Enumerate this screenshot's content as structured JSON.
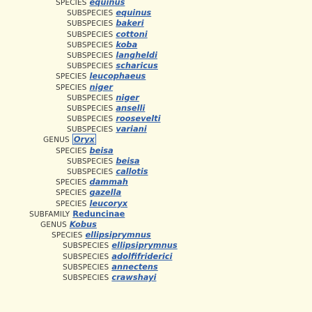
{
  "tree": [
    {
      "rank": "SPECIES",
      "name": "equinus",
      "italic": true,
      "level": "l1"
    },
    {
      "rank": "SUBSPECIES",
      "name": "equinus",
      "italic": true,
      "level": "l2"
    },
    {
      "rank": "SUBSPECIES",
      "name": "bakeri",
      "italic": true,
      "level": "l2"
    },
    {
      "rank": "SUBSPECIES",
      "name": "cottoni",
      "italic": true,
      "level": "l2"
    },
    {
      "rank": "SUBSPECIES",
      "name": "koba",
      "italic": true,
      "level": "l2"
    },
    {
      "rank": "SUBSPECIES",
      "name": "langheldi",
      "italic": true,
      "level": "l2"
    },
    {
      "rank": "SUBSPECIES",
      "name": "scharicus",
      "italic": true,
      "level": "l2"
    },
    {
      "rank": "SPECIES",
      "name": "leucophaeus",
      "italic": true,
      "level": "l1"
    },
    {
      "rank": "SPECIES",
      "name": "niger",
      "italic": true,
      "level": "l1"
    },
    {
      "rank": "SUBSPECIES",
      "name": "niger",
      "italic": true,
      "level": "l2"
    },
    {
      "rank": "SUBSPECIES",
      "name": "anselli",
      "italic": true,
      "level": "l2"
    },
    {
      "rank": "SUBSPECIES",
      "name": "roosevelti",
      "italic": true,
      "level": "l2"
    },
    {
      "rank": "SUBSPECIES",
      "name": "variani",
      "italic": true,
      "level": "l2"
    },
    {
      "rank": "GENUS",
      "name": "Oryx",
      "italic": true,
      "level": "l0",
      "boxed": true
    },
    {
      "rank": "SPECIES",
      "name": "beisa",
      "italic": true,
      "level": "l1"
    },
    {
      "rank": "SUBSPECIES",
      "name": "beisa",
      "italic": true,
      "level": "l2"
    },
    {
      "rank": "SUBSPECIES",
      "name": "callotis",
      "italic": true,
      "level": "l2"
    },
    {
      "rank": "SPECIES",
      "name": "dammah",
      "italic": true,
      "level": "l1"
    },
    {
      "rank": "SPECIES",
      "name": "gazella",
      "italic": true,
      "level": "l1"
    },
    {
      "rank": "SPECIES",
      "name": "leucoryx",
      "italic": true,
      "level": "l1"
    },
    {
      "rank": "SUBFAMILY",
      "name": "Reduncinae",
      "italic": false,
      "level": "l4"
    },
    {
      "rank": "GENUS",
      "name": "Kobus",
      "italic": true,
      "level": "l5"
    },
    {
      "rank": "SPECIES",
      "name": "ellipsiprymnus",
      "italic": true,
      "level": "l6"
    },
    {
      "rank": "SUBSPECIES",
      "name": "ellipsiprymnus",
      "italic": true,
      "level": "l7"
    },
    {
      "rank": "SUBSPECIES",
      "name": "adolfifriderici",
      "italic": true,
      "level": "l7"
    },
    {
      "rank": "SUBSPECIES",
      "name": "annectens",
      "italic": true,
      "level": "l7"
    },
    {
      "rank": "SUBSPECIES",
      "name": "crawshayi",
      "italic": true,
      "level": "l7"
    }
  ],
  "colors": {
    "background": "#fdfbe6",
    "link": "#2a5aa8",
    "rank_text": "#3a3a3a"
  }
}
